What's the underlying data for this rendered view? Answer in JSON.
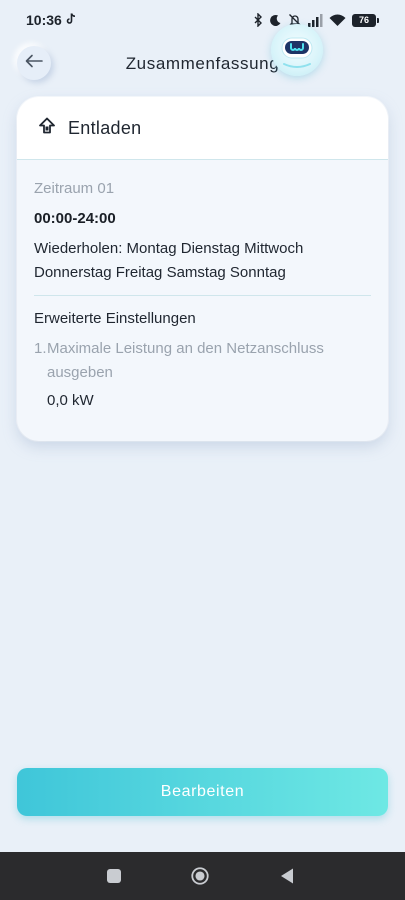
{
  "status_bar": {
    "time": "10:36",
    "battery": "76",
    "icons": [
      "tiktok-icon",
      "bluetooth-icon",
      "moon-icon",
      "mute-icon",
      "signal-icon",
      "wifi-icon",
      "battery-icon"
    ]
  },
  "header": {
    "title": "Zusammenfassung",
    "back_icon": "arrow-left-icon"
  },
  "card": {
    "icon": "discharge-icon",
    "title": "Entladen",
    "period_label": "Zeitraum 01",
    "time_range": "00:00-24:00",
    "repeat_text": "Wiederholen: Montag Dienstag Mittwoch Donnerstag Freitag Samstag Sonntag",
    "advanced_title": "Erweiterte Einstellungen",
    "option_number": "1.",
    "option_text": "Maximale Leistung an den Netzanschluss ausgeben",
    "option_value": "0,0 kW"
  },
  "actions": {
    "edit_label": "Bearbeiten"
  },
  "nav_bar": {
    "icons": [
      "recents-icon",
      "home-icon",
      "back-icon"
    ]
  },
  "colors": {
    "background": "#e9f0f8",
    "accent_start": "#3fc6d9",
    "accent_end": "#6ee8e4",
    "nav_bar": "#2b2b2d"
  }
}
